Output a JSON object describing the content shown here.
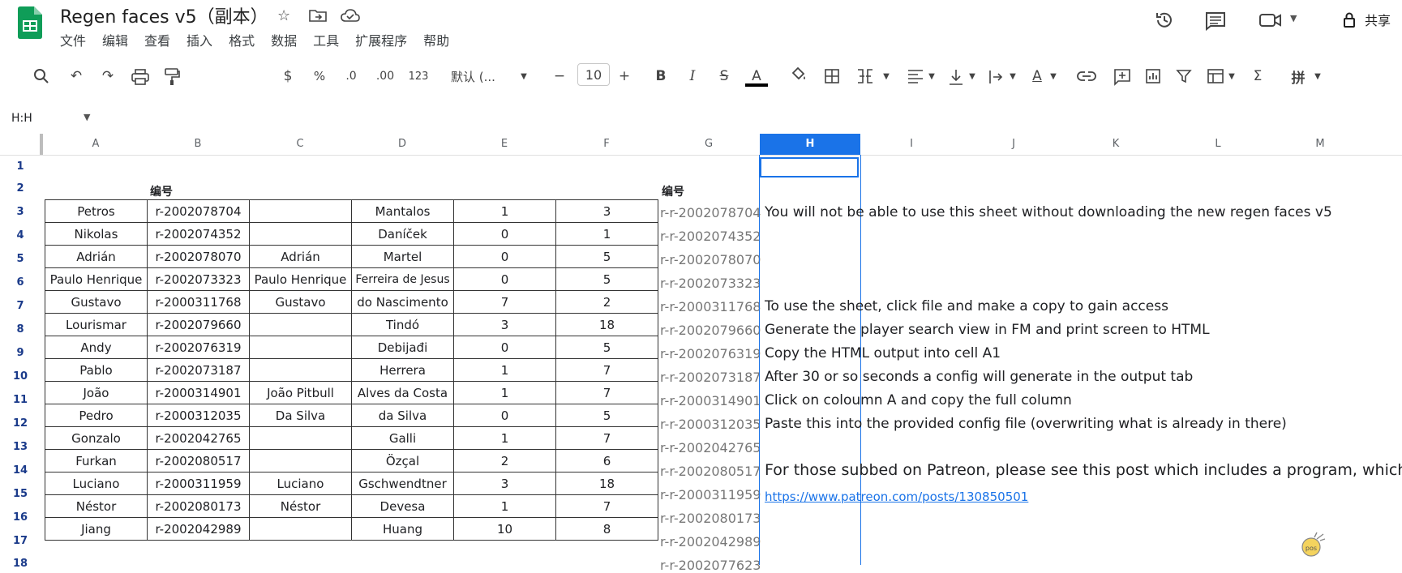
{
  "app": {
    "doc_title": "Regen faces v5（副本）",
    "menu": [
      "文件",
      "编辑",
      "查看",
      "插入",
      "格式",
      "数据",
      "工具",
      "扩展程序",
      "帮助"
    ],
    "share_label": "共享"
  },
  "toolbar": {
    "currency": "$",
    "percent": "%",
    "dec_decrease": ".0",
    "dec_increase": ".00",
    "number_format": "123",
    "font_family": "默认 (...",
    "font_size": "10",
    "bold": "B",
    "italic": "I",
    "strike": "S",
    "text_color": "A",
    "input_tool": "拼",
    "sum": "Σ"
  },
  "name_box": "H:H",
  "columns": [
    "A",
    "B",
    "C",
    "D",
    "E",
    "F",
    "G",
    "H",
    "I",
    "J",
    "K",
    "L",
    "M"
  ],
  "selected_column": "H",
  "rows": [
    "1",
    "2",
    "3",
    "4",
    "5",
    "6",
    "7",
    "8",
    "9",
    "10",
    "11",
    "12",
    "13",
    "14",
    "15",
    "16",
    "17",
    "18"
  ],
  "labels": {
    "b2": "编号",
    "g2": "编号"
  },
  "table": [
    [
      "Petros",
      "r-2002078704",
      "",
      "Mantalos",
      "1",
      "3"
    ],
    [
      "Nikolas",
      "r-2002074352",
      "",
      "Daníček",
      "0",
      "1"
    ],
    [
      "Adrián",
      "r-2002078070",
      "Adrián",
      "Martel",
      "0",
      "5"
    ],
    [
      "Paulo Henrique",
      "r-2002073323",
      "Paulo Henrique",
      "Ferreira de Jesus",
      "0",
      "5"
    ],
    [
      "Gustavo",
      "r-2000311768",
      "Gustavo",
      "do Nascimento",
      "7",
      "2"
    ],
    [
      "Lourismar",
      "r-2002079660",
      "",
      "Tindó",
      "3",
      "18"
    ],
    [
      "Andy",
      "r-2002076319",
      "",
      "Debijađi",
      "0",
      "5"
    ],
    [
      "Pablo",
      "r-2002073187",
      "",
      "Herrera",
      "1",
      "7"
    ],
    [
      "João",
      "r-2000314901",
      "João Pitbull",
      "Alves da Costa",
      "1",
      "7"
    ],
    [
      "Pedro",
      "r-2000312035",
      "Da Silva",
      "da Silva",
      "0",
      "5"
    ],
    [
      "Gonzalo",
      "r-2002042765",
      "",
      "Galli",
      "1",
      "7"
    ],
    [
      "Furkan",
      "r-2002080517",
      "",
      "Özçal",
      "2",
      "6"
    ],
    [
      "Luciano",
      "r-2000311959",
      "Luciano",
      "Gschwendtner",
      "3",
      "18"
    ],
    [
      "Néstor",
      "r-2002080173",
      "Néstor",
      "Devesa",
      "1",
      "7"
    ],
    [
      "Jiang",
      "r-2002042989",
      "",
      "Huang",
      "10",
      "8"
    ]
  ],
  "col_g": [
    "r-r-2002078704",
    "r-r-2002074352",
    "r-r-2002078070",
    "r-r-2002073323",
    "r-r-2000311768",
    "r-r-2002079660",
    "r-r-2002076319",
    "r-r-2002073187",
    "r-r-2000314901",
    "r-r-2000312035",
    "r-r-2002042765",
    "r-r-2002080517",
    "r-r-2000311959",
    "r-r-2002080173",
    "r-r-2002042989",
    "r-r-2002077623"
  ],
  "notes": {
    "r3": "You will not be able to use this sheet without downloading the new regen faces v5",
    "r7": "To use the sheet, click file and make a copy to gain access",
    "r8": "Generate the player search view in FM and print screen to HTML",
    "r9": "Copy the HTML output into cell A1",
    "r10": "After 30 or so seconds a config will generate in the output tab",
    "r11": "Click on coloumn A and copy the full column",
    "r12": "Paste this into the provided config file (overwriting what is already in there)",
    "r14": "For those subbed on Patreon, please see this post which includes a program, which mea",
    "r15_link": "https://www.patreon.com/posts/130850501"
  },
  "colors": {
    "accent": "#1a73e8",
    "logo_green": "#0f9d58"
  }
}
